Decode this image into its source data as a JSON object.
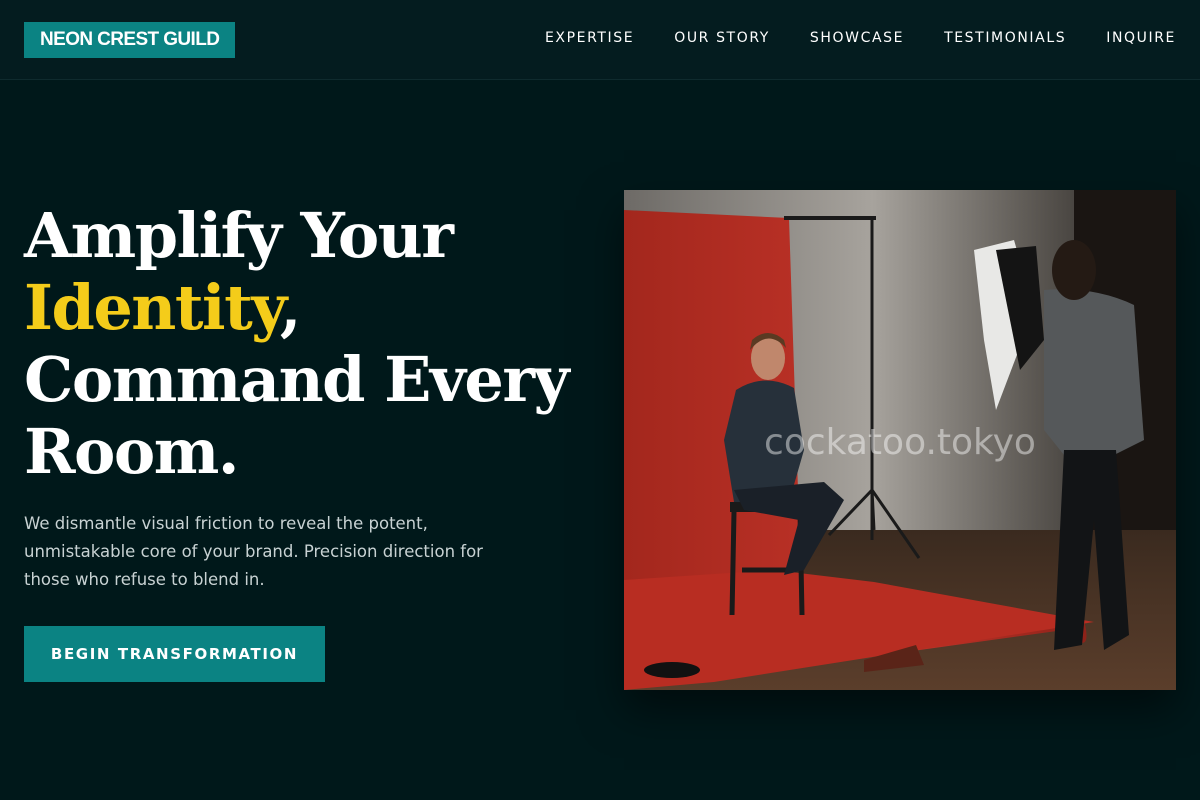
{
  "header": {
    "logo": "NEON CREST GUILD",
    "nav": [
      "EXPERTISE",
      "OUR STORY",
      "SHOWCASE",
      "TESTIMONIALS",
      "INQUIRE"
    ]
  },
  "hero": {
    "title_line1": "Amplify Your",
    "title_accent": "Identity",
    "title_comma": ",",
    "title_line3": "Command Every",
    "title_line4": "Room.",
    "body": "We dismantle visual friction to reveal the potent, unmistakable core of your brand. Precision direction for those who refuse to blend in.",
    "cta": "BEGIN TRANSFORMATION"
  },
  "photo": {
    "watermark": "cockatoo.tokyo"
  },
  "colors": {
    "background": "#00181a",
    "brand": "#0b8383",
    "accent": "#f4cc1a"
  }
}
